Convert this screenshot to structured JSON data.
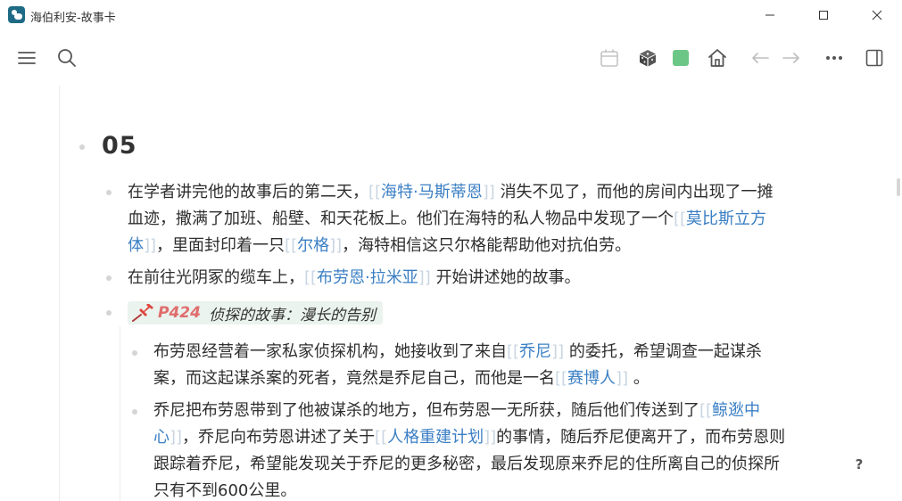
{
  "window": {
    "title": "海伯利安-故事卡",
    "icons": [
      "app-icon",
      "minimize-icon",
      "maximize-icon",
      "close-icon"
    ]
  },
  "toolbar": {
    "icons": [
      "menu-icon",
      "search-icon",
      "calendar-icon",
      "dice-icon",
      "green-square-icon",
      "home-icon",
      "arrow-left-icon",
      "arrow-right-icon",
      "more-icon",
      "sidebar-toggle-icon"
    ],
    "accent_green": "#6cc686"
  },
  "content": {
    "heading": "05",
    "p1": {
      "l1a": "在学者讲完他的故事后的第二天，",
      "link1": "海特·马斯蒂恩",
      "l1b": "消失不见了，而他的房间内出现了一摊",
      "l2a": "血迹，撒满了加班、船壁、和天花板上。他们在海特的私人物品中发现了一个",
      "link2a": "莫比斯立方",
      "link2b": "体",
      "l3a": "，里面封印着一只",
      "link3": "尔格",
      "l3b": "，海特相信这只尔格能帮助他对抗伯劳。"
    },
    "p2": {
      "a": "在前往光阴冢的缆车上，",
      "link": "布劳恩·拉米亚",
      "b": "开始讲述她的故事。"
    },
    "callout": {
      "page": "P424",
      "title": "侦探的故事：漫长的告别"
    },
    "s1": {
      "l1a": "布劳恩经营着一家私家侦探机构，她接收到了来自",
      "link1": "乔尼",
      "l1b": "的委托，希望调查一起谋杀",
      "l2a": "案，而这起谋杀案的死者，竟然是乔尼自己，而他是一名",
      "link2": "赛博人",
      "l2b": "。"
    },
    "s2": {
      "l1a": "乔尼把布劳恩带到了他被谋杀的地方，但布劳恩一无所获，随后他们传送到了",
      "link1a": "鲸逖中",
      "link1b": "心",
      "l2a": "，乔尼向布劳恩讲述了关于",
      "link2": "人格重建计划",
      "l2b": "的事情，随后乔尼便离开了，而布劳恩则",
      "l3": "跟踪着乔尼，希望能发现关于乔尼的更多秘密，最后发现原来乔尼的住所离自己的侦探所",
      "l4": "只有不到600公里。"
    },
    "link_color": "#3b7fc4",
    "bracket_color": "#c9d6e2",
    "help": "?"
  }
}
